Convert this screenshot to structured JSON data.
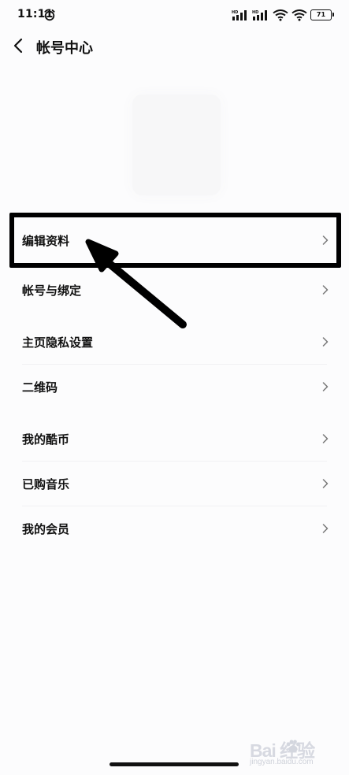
{
  "status_bar": {
    "time": "11:11",
    "battery": "71",
    "icons": [
      "alarm-icon",
      "hd-signal-icon",
      "hd-signal-icon",
      "wifi-icon",
      "wifi-icon",
      "battery-icon"
    ]
  },
  "header": {
    "back_icon": "chevron-left-icon",
    "title": "帐号中心"
  },
  "menu": {
    "items": [
      {
        "label": "编辑资料"
      },
      {
        "label": "帐号与绑定"
      },
      {
        "label": "主页隐私设置"
      },
      {
        "label": "二维码"
      },
      {
        "label": "我的酷币"
      },
      {
        "label": "已购音乐"
      },
      {
        "label": "我的会员"
      }
    ],
    "chevron_icon": "chevron-right-icon"
  },
  "annotation": {
    "box_color": "#000000",
    "arrow_color": "#000000"
  },
  "watermark": {
    "logo": "Bai 经验",
    "site": "jingyan.baidu.com"
  }
}
